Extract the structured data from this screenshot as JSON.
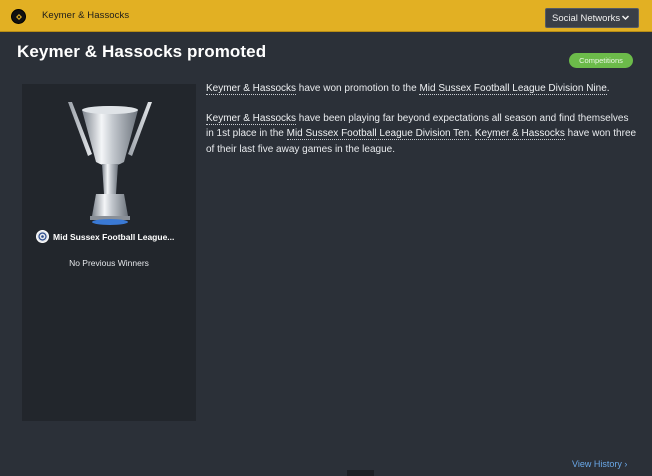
{
  "topbar": {
    "club_name": "Keymer & Hassocks",
    "club_badge_icon": "club-badge-icon",
    "social_button_label": "Social Networks",
    "social_button_icon": "chevron-down-icon"
  },
  "colors": {
    "topbar": "#e2b023",
    "background": "#2b3038",
    "panel": "#22262c",
    "tag": "#6cbb4a",
    "link_accent": "#6aa8e8"
  },
  "headline": "Keymer & Hassocks promoted",
  "tag_label": "Competitions",
  "panel": {
    "trophy_icon": "trophy-icon",
    "competition_icon": "competition-logo-icon",
    "competition_name": "Mid Sussex Football League...",
    "no_winners_text": "No Previous Winners"
  },
  "article": {
    "p1": {
      "club": "Keymer & Hassocks",
      "text1": " have won promotion to the ",
      "league": "Mid Sussex Football League Division Nine",
      "end": "."
    },
    "p2": {
      "club1": "Keymer & Hassocks",
      "text1": " have been playing far beyond expectations all season and find themselves in 1st place in the ",
      "league": "Mid Sussex Football League Division Ten",
      "text2": ". ",
      "club2": "Keymer & Hassocks",
      "text3": " have won three of their last five away games in the league."
    }
  },
  "footer": {
    "view_history_label": "View History",
    "view_history_icon": "chevron-right-icon",
    "view_history_arrow": "›"
  }
}
